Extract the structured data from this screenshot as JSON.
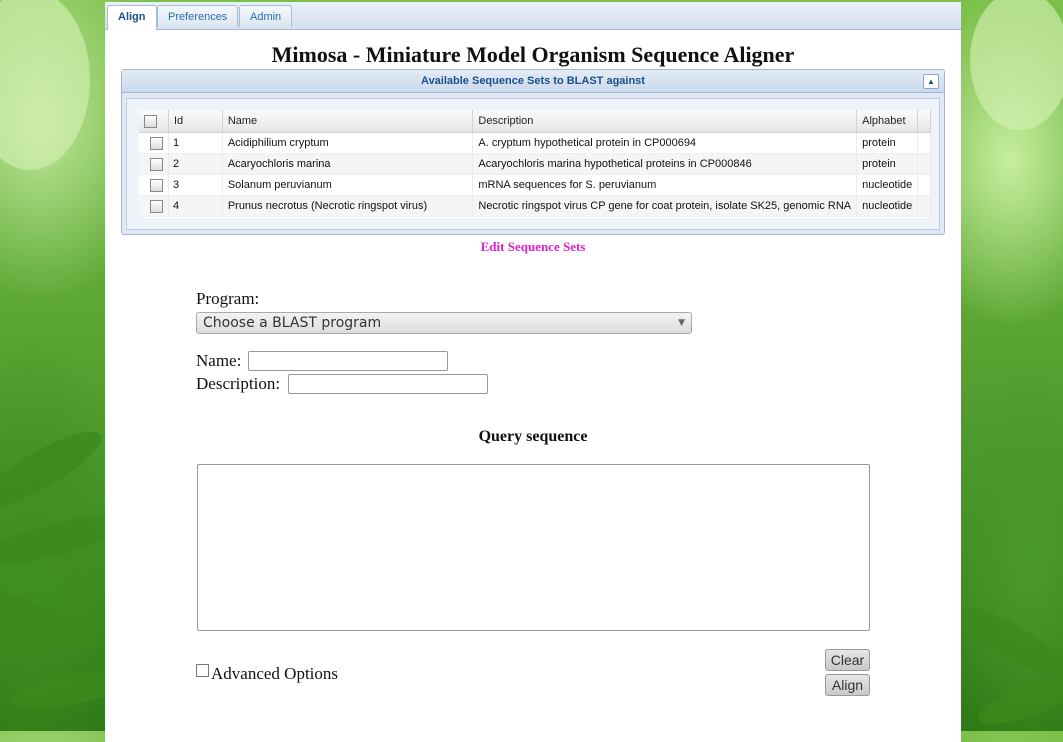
{
  "tabs": [
    {
      "label": "Align",
      "active": true
    },
    {
      "label": "Preferences",
      "active": false
    },
    {
      "label": "Admin",
      "active": false
    }
  ],
  "title": "Mimosa - Miniature Model Organism Sequence Aligner",
  "panel": {
    "header": "Available Sequence Sets to BLAST against",
    "columns": [
      "Id",
      "Name",
      "Description",
      "Alphabet"
    ],
    "rows": [
      {
        "id": "1",
        "name": "Acidiphilium cryptum",
        "description": "A. cryptum hypothetical protein in CP000694",
        "alphabet": "protein"
      },
      {
        "id": "2",
        "name": "Acaryochloris marina",
        "description": "Acaryochloris marina hypothetical proteins in CP000846",
        "alphabet": "protein"
      },
      {
        "id": "3",
        "name": "Solanum peruvianum",
        "description": "mRNA sequences for S. peruvianum",
        "alphabet": "nucleotide"
      },
      {
        "id": "4",
        "name": "Prunus necrotus (Necrotic ringspot virus)",
        "description": "Necrotic ringspot virus CP gene for coat protein, isolate SK25, genomic RNA",
        "alphabet": "nucleotide"
      }
    ]
  },
  "edit_link": "Edit Sequence Sets",
  "form": {
    "program_label": "Program:",
    "program_selected": "Choose a BLAST program",
    "name_label": "Name:",
    "name_value": "",
    "description_label": "Description:",
    "description_value": "",
    "query_title": "Query sequence",
    "query_value": "",
    "advanced_label": "Advanced Options",
    "clear_label": "Clear",
    "align_label": "Align"
  },
  "colors": {
    "accent": "#1d4f8a",
    "link": "#e020c8",
    "tab_text": "#2e6ab1"
  }
}
